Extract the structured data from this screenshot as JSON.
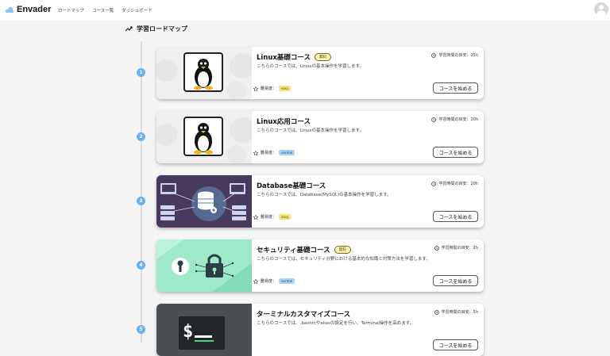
{
  "app": {
    "name": "Envader"
  },
  "nav": {
    "items": [
      "ロードマップ",
      "コース一覧",
      "ダッシュボード"
    ]
  },
  "page": {
    "title": "学習ロードマップ"
  },
  "difficulty_label": "難易度：",
  "courses": [
    {
      "step": "1",
      "title": "Linux基礎コース",
      "tag": "無料",
      "description": "こちらのコースでは、Linuxの基本操作を学習します。",
      "time": "学習時間の目安：15h",
      "difficulty": "easy",
      "button": "コースを始める",
      "thumb": "linux"
    },
    {
      "step": "2",
      "title": "Linux応用コース",
      "tag": "",
      "description": "こちらのコースでは、Linuxの基本操作を学習します。",
      "time": "学習時間の目安：20h",
      "difficulty": "normal",
      "button": "コースを始める",
      "thumb": "linux"
    },
    {
      "step": "3",
      "title": "Database基礎コース",
      "tag": "",
      "description": "こちらのコースでは、Database(MySQL)の基本操作を学習します。",
      "time": "学習時間の目安：20h",
      "difficulty": "easy",
      "button": "コースを始める",
      "thumb": "database"
    },
    {
      "step": "4",
      "title": "セキュリティ基礎コース",
      "tag": "無料",
      "description": "こちらのコースでは、セキュリティ分野における基本的な知識と対策方法を学習します。",
      "time": "学習時間の目安：2h",
      "difficulty": "normal",
      "button": "コースを始める",
      "thumb": "security"
    },
    {
      "step": "5",
      "title": "ターミナルカスタマイズコース",
      "tag": "",
      "description": "こちらのコースでは、.bashrcやaliasの設定を行い、Terminal操作を高めます。",
      "time": "学習時間の目安：5h",
      "difficulty": "",
      "button": "コースを始める",
      "thumb": "terminal"
    }
  ]
}
